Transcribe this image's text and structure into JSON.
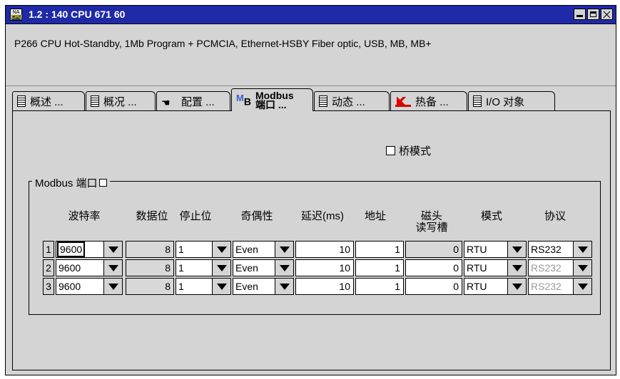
{
  "window": {
    "title": "1.2 : 140 CPU 671 60",
    "icon_top": "NA",
    "icon_bottom": "CPU",
    "icon_name": "cpu-module-icon"
  },
  "description": "P266 CPU Hot-Standby, 1Mb Program + PCMCIA, Ethernet-HSBY Fiber optic, USB, MB, MB+",
  "tabs": [
    {
      "label": "概述 ...",
      "icon": "module-icon"
    },
    {
      "label": "概况 ...",
      "icon": "module-icon"
    },
    {
      "label": "配置 ...",
      "icon": "hand-icon"
    },
    {
      "label_line1": "Modbus",
      "label_line2": "端口 ...",
      "icon_prefix_m": "M",
      "icon_prefix_b": "B",
      "active": true
    },
    {
      "label": "动态 ...",
      "icon": "module-icon"
    },
    {
      "label": "热备 ...",
      "icon": "hot-standby-icon"
    },
    {
      "label": "I/O 对象",
      "icon": "module-icon"
    }
  ],
  "bridge_mode_label": "桥模式",
  "group_label": "Modbus 端口",
  "columns": {
    "baud": "波特率",
    "databits": "数据位",
    "stopbits": "停止位",
    "parity": "奇偶性",
    "delay": "延迟(ms)",
    "address": "地址",
    "head_slot_line1": "磁头",
    "head_slot_line2": "读写槽",
    "mode": "模式",
    "protocol": "协议"
  },
  "rows": [
    {
      "index": "1",
      "baud": "9600",
      "databits": "8",
      "stopbits": "1",
      "parity": "Even",
      "delay": "10",
      "address": "1",
      "head_slot": "0",
      "mode": "RTU",
      "protocol": "RS232"
    },
    {
      "index": "2",
      "baud": "9600",
      "databits": "8",
      "stopbits": "1",
      "parity": "Even",
      "delay": "10",
      "address": "1",
      "head_slot": "0",
      "mode": "RTU",
      "protocol": "RS232"
    },
    {
      "index": "3",
      "baud": "9600",
      "databits": "8",
      "stopbits": "1",
      "parity": "Even",
      "delay": "10",
      "address": "1",
      "head_slot": "0",
      "mode": "RTU",
      "protocol": "RS232"
    }
  ],
  "colors": {
    "titlebar": "#1e2aa8",
    "window_bg": "#d4d4d4",
    "disabled_text": "#9a9a9a"
  }
}
